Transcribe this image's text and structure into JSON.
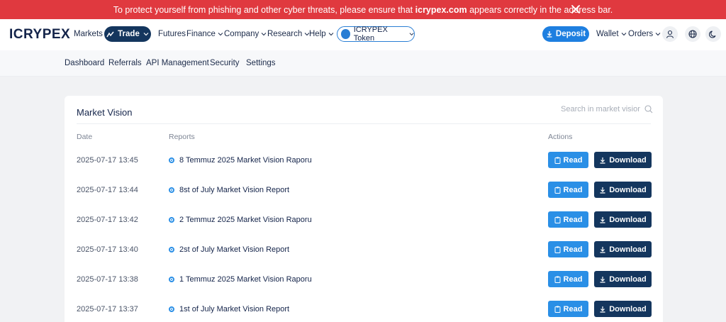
{
  "banner": {
    "text_before": "To protect yourself from phishing and other cyber threats, please ensure that ",
    "domain": "icrypex.com",
    "text_after": " appears correctly in the address bar."
  },
  "header": {
    "logo": "ICRYPEX",
    "nav": {
      "markets": "Markets",
      "trade": "Trade",
      "futures": "Futures",
      "finance": "Finance",
      "company": "Company",
      "research": "Research",
      "help": "Help",
      "token": "ICRYPEX Token"
    },
    "deposit": "Deposit",
    "wallet": "Wallet",
    "orders": "Orders"
  },
  "subnav": [
    "Dashboard",
    "Referrals",
    "API Management",
    "Security",
    "Settings"
  ],
  "card": {
    "title": "Market Vision",
    "search_placeholder": "Search in market vision",
    "columns": {
      "date": "Date",
      "reports": "Reports",
      "actions": "Actions"
    },
    "read_label": "Read",
    "download_label": "Download",
    "rows": [
      {
        "date": "2025-07-17 13:45",
        "report": "8 Temmuz 2025 Market Vision Raporu"
      },
      {
        "date": "2025-07-17 13:44",
        "report": "8st of July Market Vision Report"
      },
      {
        "date": "2025-07-17 13:42",
        "report": "2 Temmuz 2025 Market Vision Raporu"
      },
      {
        "date": "2025-07-17 13:40",
        "report": "2st of July Market Vision Report"
      },
      {
        "date": "2025-07-17 13:38",
        "report": "1 Temmuz 2025 Market Vision Raporu"
      },
      {
        "date": "2025-07-17 13:37",
        "report": "1st of July Market Vision Report"
      }
    ]
  },
  "colors": {
    "banner": "#e0393f",
    "primary_navy": "#14365e",
    "accent_blue": "#2a8fe6"
  }
}
